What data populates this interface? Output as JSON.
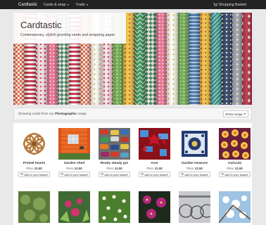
{
  "navbar": {
    "brand": "Cardtastic",
    "menu": [
      {
        "label": "Cards & wrap"
      },
      {
        "label": "Trade"
      }
    ],
    "basket_label": "Shopping Basket"
  },
  "hero": {
    "title": "Cardtastic",
    "subtitle": "Contemporary, stylish greeting cards and wrapping paper."
  },
  "range_bar": {
    "prefix": "Showing cards from our",
    "range_name": "Photographic",
    "suffix": "range",
    "show_range_label": "Show range"
  },
  "products": [
    {
      "title": "Pretzel hearts",
      "price_label": "Price:",
      "price": "£1.50",
      "button": "Add to your basket"
    },
    {
      "title": "Garden shed",
      "price_label": "Price:",
      "price": "£1.50",
      "button": "Add to your basket"
    },
    {
      "title": "Ready steady go!",
      "price_label": "Price:",
      "price": "£1.50",
      "button": "Add to your basket"
    },
    {
      "title": "Acer",
      "price_label": "Price:",
      "price": "£1.50",
      "button": "Add to your basket"
    },
    {
      "title": "Garden treasure",
      "price_label": "Price:",
      "price": "£1.50",
      "button": "Add to your basket"
    },
    {
      "title": "Auricula",
      "price_label": "Price:",
      "price": "£1.50",
      "button": "Add to your basket"
    }
  ],
  "colors": {
    "navbar_bg": "#222222",
    "page_bg": "#e9e9e9"
  }
}
